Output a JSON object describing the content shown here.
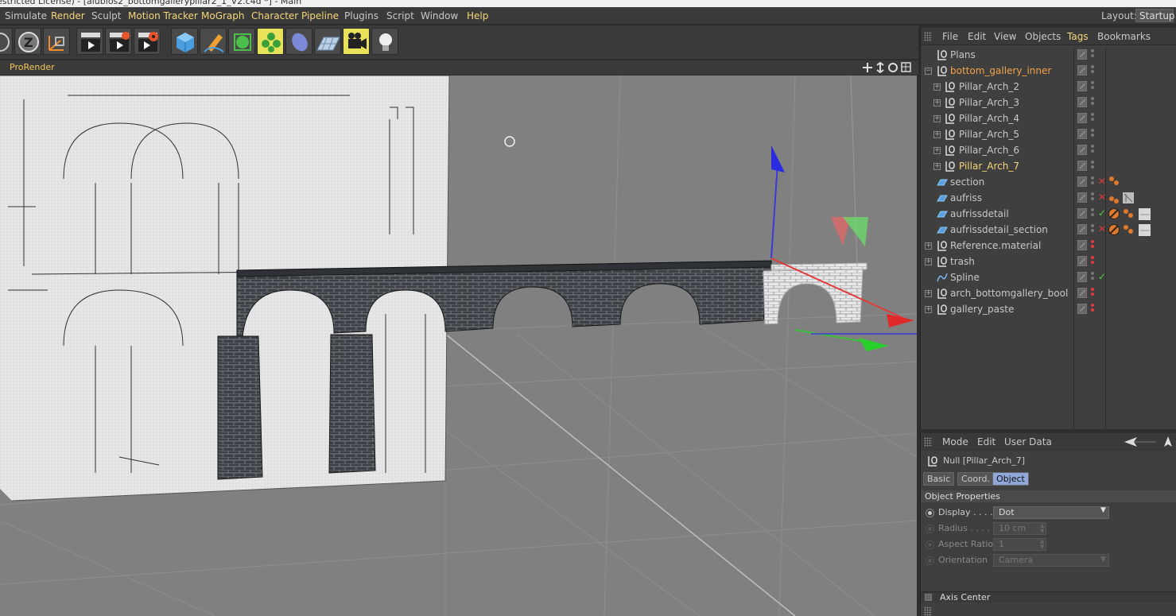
{
  "title_bar": {
    "text": "estricted License) - [alubios2_bottomgallerypillar2_1_V2.c4d *] - Main"
  },
  "menubar": {
    "items": [
      {
        "label": "Simulate",
        "highlight": false
      },
      {
        "label": "Render",
        "highlight": true
      },
      {
        "label": "Sculpt",
        "highlight": false
      },
      {
        "label": "Motion Tracker",
        "highlight": true
      },
      {
        "label": "MoGraph",
        "highlight": true
      },
      {
        "label": "Character",
        "highlight": true
      },
      {
        "label": "Pipeline",
        "highlight": true
      },
      {
        "label": "Plugins",
        "highlight": false
      },
      {
        "label": "Script",
        "highlight": false
      },
      {
        "label": "Window",
        "highlight": false
      },
      {
        "label": "Help",
        "highlight": true
      }
    ],
    "layout_label": "Layout:",
    "layout_value": "Startup"
  },
  "toolbar": {
    "buttons": [
      {
        "icon": "rotate-axis-icon"
      },
      {
        "icon": "z-axis-icon"
      },
      {
        "icon": "coordinate-system-icon"
      },
      {
        "icon": "render-view-icon"
      },
      {
        "icon": "render-picture-viewer-icon"
      },
      {
        "icon": "render-settings-icon"
      },
      {
        "icon": "cube-primitive-icon"
      },
      {
        "icon": "pen-spline-icon"
      },
      {
        "icon": "subdivision-surface-icon"
      },
      {
        "icon": "cloner-icon"
      },
      {
        "icon": "deformer-icon"
      },
      {
        "icon": "floor-icon"
      },
      {
        "icon": "camera-icon"
      },
      {
        "icon": "light-icon"
      }
    ]
  },
  "viewport": {
    "title": "ProRender"
  },
  "object_manager": {
    "menu": [
      {
        "label": "File",
        "highlight": false
      },
      {
        "label": "Edit",
        "highlight": false
      },
      {
        "label": "View",
        "highlight": false
      },
      {
        "label": "Objects",
        "highlight": false
      },
      {
        "label": "Tags",
        "highlight": true
      },
      {
        "label": "Bookmarks",
        "highlight": false
      }
    ],
    "objects": [
      {
        "name": "Plans",
        "type": "null",
        "state": "normal"
      },
      {
        "name": "bottom_gallery_inner",
        "type": "null",
        "state": "selected"
      },
      {
        "name": "Pillar_Arch_2",
        "type": "null",
        "state": "normal"
      },
      {
        "name": "Pillar_Arch_3",
        "type": "null",
        "state": "normal"
      },
      {
        "name": "Pillar_Arch_4",
        "type": "null",
        "state": "normal"
      },
      {
        "name": "Pillar_Arch_5",
        "type": "null",
        "state": "normal"
      },
      {
        "name": "Pillar_Arch_6",
        "type": "null",
        "state": "normal"
      },
      {
        "name": "Pillar_Arch_7",
        "type": "null",
        "state": "active"
      },
      {
        "name": "section",
        "type": "plane",
        "state": "normal"
      },
      {
        "name": "aufriss",
        "type": "plane",
        "state": "normal"
      },
      {
        "name": "aufrissdetail",
        "type": "plane",
        "state": "normal"
      },
      {
        "name": "aufrissdetail_section",
        "type": "plane",
        "state": "normal"
      },
      {
        "name": "Reference.material",
        "type": "null",
        "state": "normal"
      },
      {
        "name": "trash",
        "type": "null",
        "state": "normal"
      },
      {
        "name": "Spline",
        "type": "spline",
        "state": "normal"
      },
      {
        "name": "arch_bottomgallery_bool",
        "type": "null",
        "state": "normal"
      },
      {
        "name": "gallery_paste",
        "type": "null",
        "state": "normal"
      }
    ]
  },
  "attributes": {
    "menu": [
      "Mode",
      "Edit",
      "User Data"
    ],
    "object_label": "Null [Pillar_Arch_7]",
    "tabs": [
      {
        "label": "Basic",
        "active": false
      },
      {
        "label": "Coord.",
        "active": false
      },
      {
        "label": "Object",
        "active": true
      }
    ],
    "section_title": "Object Properties",
    "fields": [
      {
        "label": "Display . . . .",
        "value": "Dot",
        "enabled": true
      },
      {
        "label": "Radius . . . .",
        "value": "10 cm",
        "enabled": false
      },
      {
        "label": "Aspect Ratio",
        "value": "1",
        "enabled": false
      },
      {
        "label": "Orientation",
        "value": "Camera",
        "enabled": false
      }
    ],
    "axis_center_label": "Axis Center"
  },
  "colors": {
    "highlight_text": "#f5d77a",
    "selected_text": "#f5a24a",
    "viewport_bg": "#808080",
    "panel_bg": "#3f3f3f"
  }
}
